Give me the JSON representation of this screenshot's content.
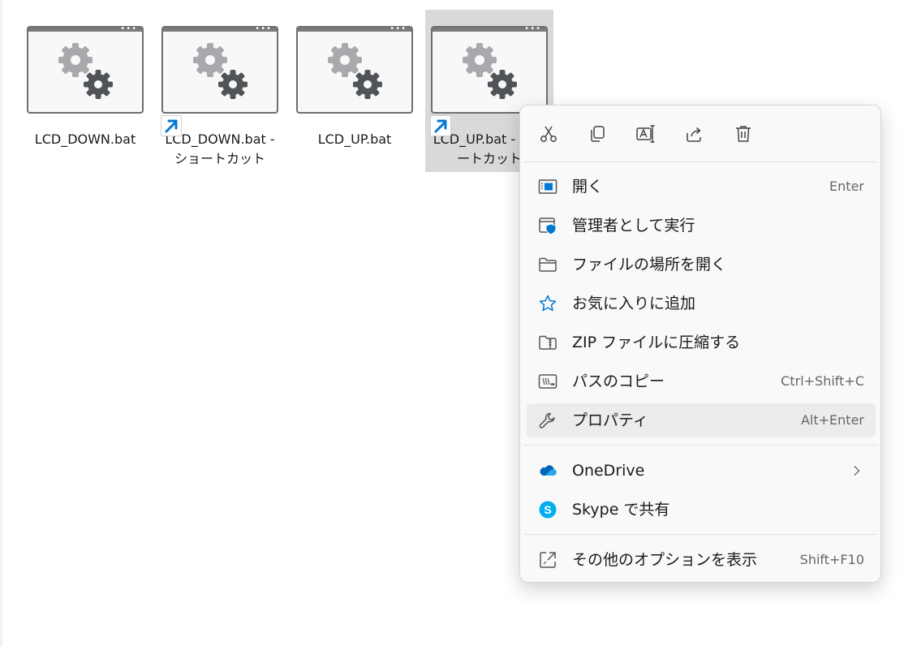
{
  "files": [
    {
      "name": "LCD_DOWN.bat",
      "shortcut": false,
      "selected": false
    },
    {
      "name": "LCD_DOWN.bat - ショートカット",
      "shortcut": true,
      "selected": false
    },
    {
      "name": "LCD_UP.bat",
      "shortcut": false,
      "selected": false
    },
    {
      "name": "LCD_UP.bat - ショートカット",
      "shortcut": true,
      "selected": true
    }
  ],
  "context_menu": {
    "quick_actions": [
      {
        "icon": "cut-icon"
      },
      {
        "icon": "copy-icon"
      },
      {
        "icon": "rename-icon"
      },
      {
        "icon": "share-icon"
      },
      {
        "icon": "delete-icon"
      }
    ],
    "items": [
      {
        "label": "開く",
        "shortcut": "Enter",
        "icon": "open-window-icon"
      },
      {
        "label": "管理者として実行",
        "shortcut": "",
        "icon": "run-as-admin-shield-icon"
      },
      {
        "label": "ファイルの場所を開く",
        "shortcut": "",
        "icon": "folder-icon"
      },
      {
        "label": "お気に入りに追加",
        "shortcut": "",
        "icon": "star-icon"
      },
      {
        "label": "ZIP ファイルに圧縮する",
        "shortcut": "",
        "icon": "zip-folder-icon"
      },
      {
        "label": "パスのコピー",
        "shortcut": "Ctrl+Shift+C",
        "icon": "copy-path-icon"
      },
      {
        "label": "プロパティ",
        "shortcut": "Alt+Enter",
        "icon": "wrench-icon",
        "hovered": true
      },
      {
        "label": "OneDrive",
        "shortcut": "",
        "icon": "onedrive-cloud-icon",
        "submenu": true
      },
      {
        "label": "Skype で共有",
        "shortcut": "",
        "icon": "skype-icon"
      },
      {
        "label": "その他のオプションを表示",
        "shortcut": "Shift+F10",
        "icon": "more-options-icon"
      }
    ]
  },
  "colors": {
    "accent": "#0078d4",
    "selection": "#d9d9d9",
    "menu_background": "#f9f9f9",
    "menu_hover": "#ececec",
    "onedrive": "#0364b8",
    "skype": "#00aff0"
  }
}
